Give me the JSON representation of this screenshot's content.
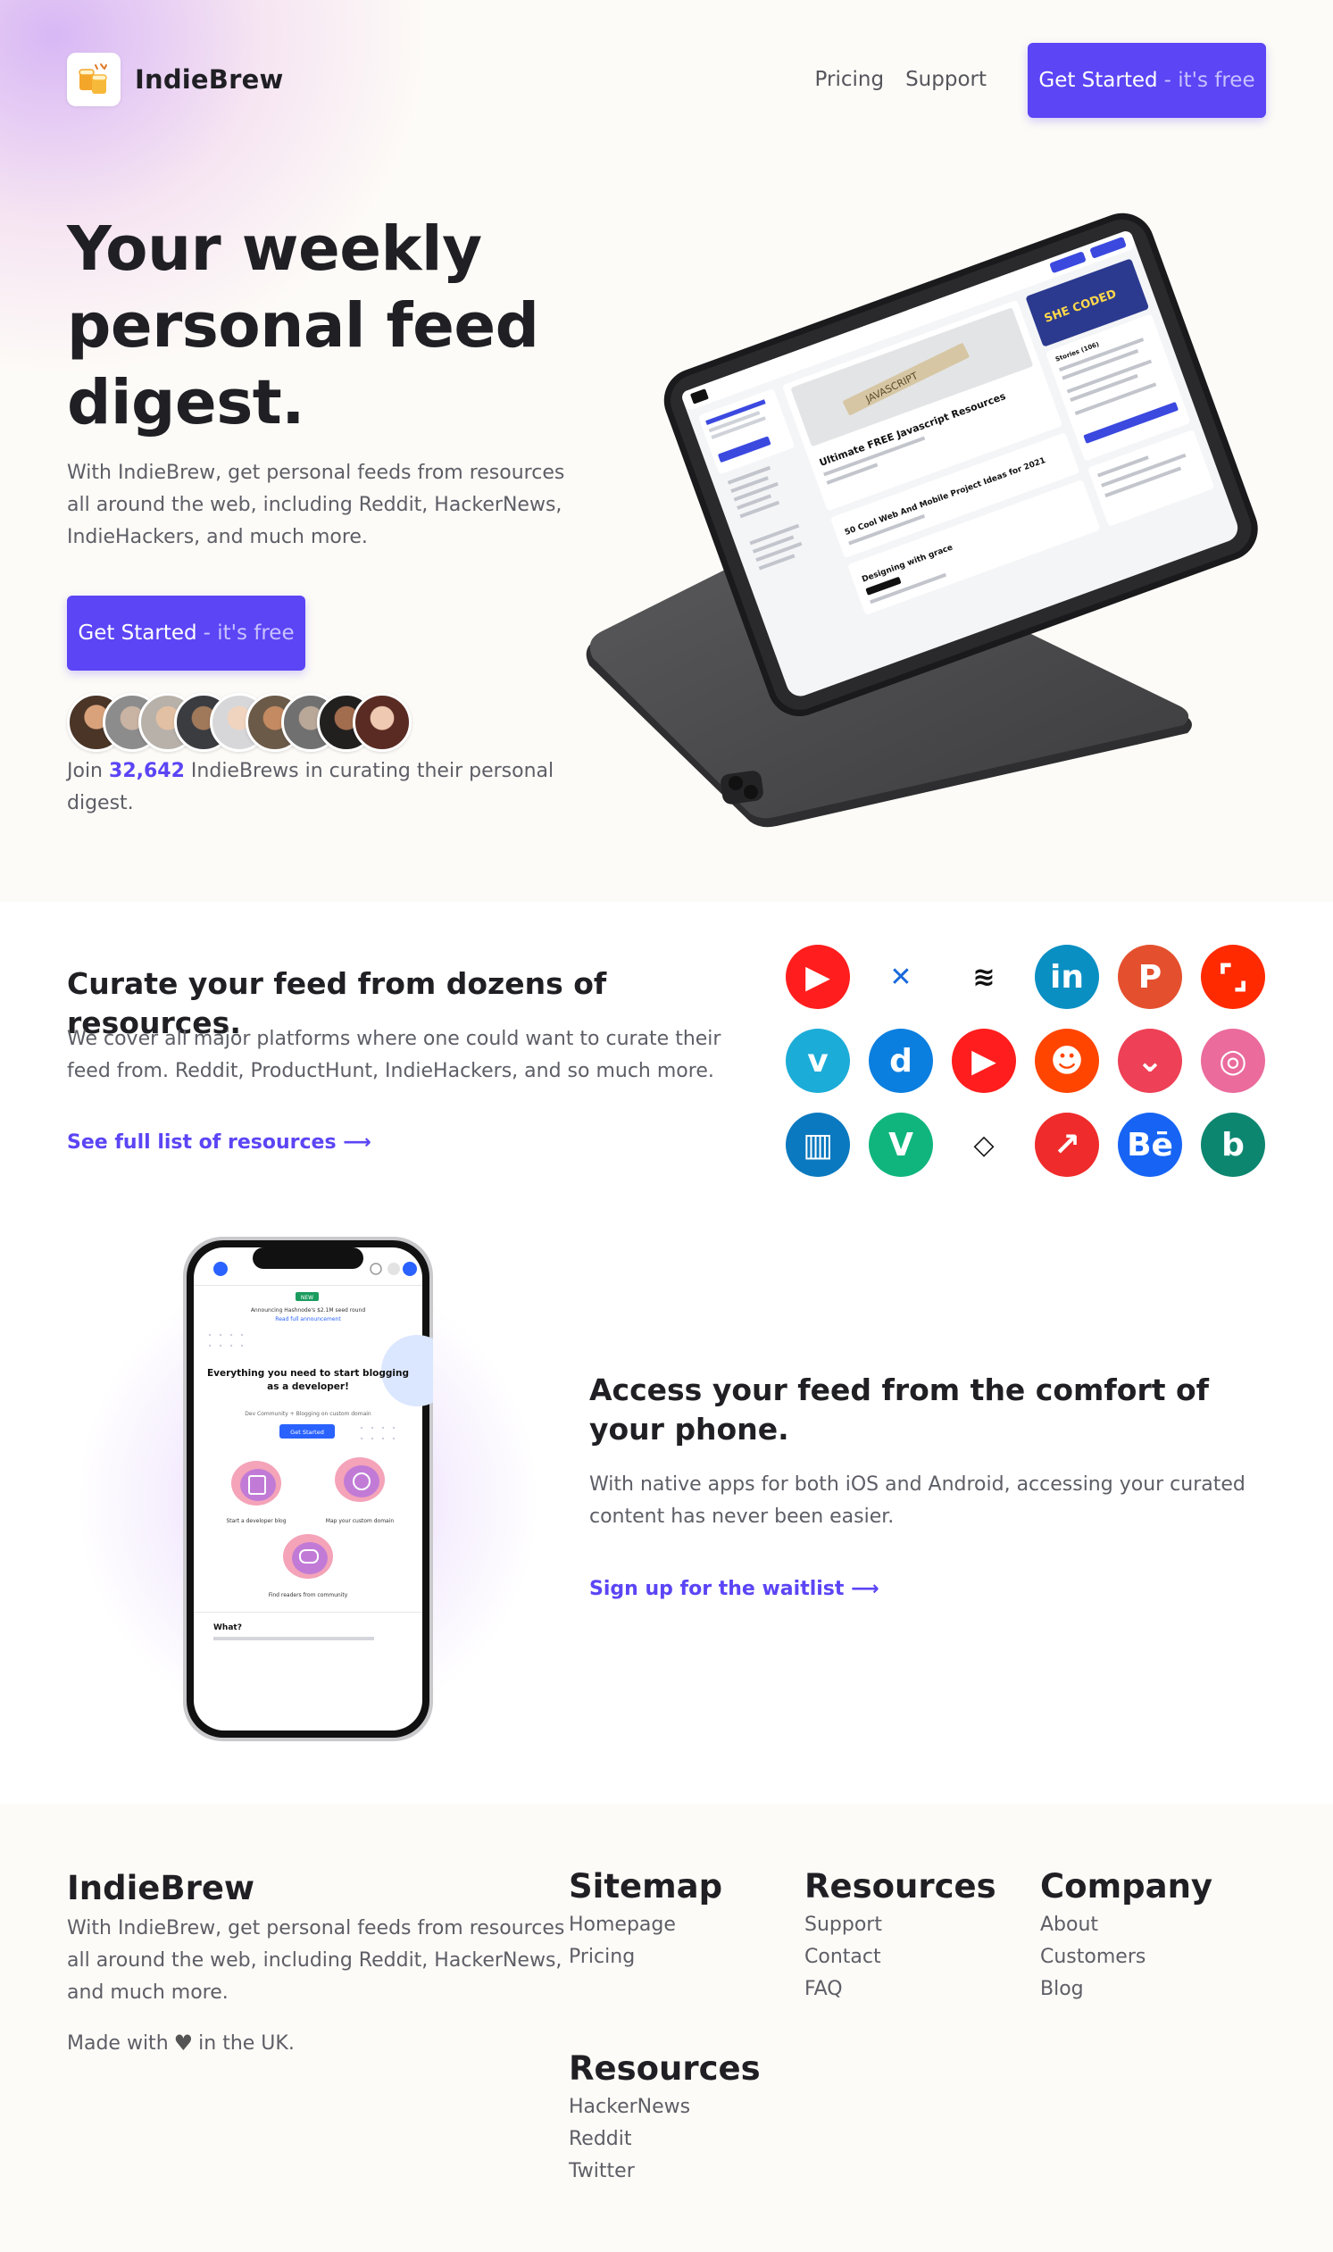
{
  "nav": {
    "brand": "IndieBrew",
    "links": [
      "Pricing",
      "Support"
    ],
    "cta_main": "Get Started",
    "cta_muted": "- it's free"
  },
  "hero": {
    "title": "Your weekly personal feed digest.",
    "subtitle": "With IndieBrew, get personal feeds from resources all around the web, including Reddit, HackerNews, IndieHackers, and much more.",
    "cta_main": "Get Started",
    "cta_muted": "- it's free",
    "join_prefix": "Join",
    "join_count": "32,642",
    "join_suffix": "IndieBrews in curating their personal digest."
  },
  "tablet": {
    "story_count": "Stories (106)",
    "post1": "Ultimate FREE Javascript Resources",
    "post2": "50 Cool Web And Mobile Project Ideas for 2021",
    "post3": "Designing with grace",
    "banner": "SHE CODED",
    "photo_word": "JAVASCRIPT"
  },
  "resources": {
    "title": "Curate your feed from dozens of resources.",
    "text": "We cover all major platforms where one could want to curate their feed from. Reddit, ProductHunt, IndieHackers, and so much more.",
    "link": "See full list of resources",
    "icons": [
      {
        "name": "youtube-icon",
        "bg": "#ff1d1d",
        "fg": "#ffffff",
        "glyph": "▶",
        "ring": false
      },
      {
        "name": "confluence-icon",
        "bg": "#ffffff",
        "fg": "#1868db",
        "glyph": "✕",
        "ring": false
      },
      {
        "name": "buffer-icon",
        "bg": "#ffffff",
        "fg": "#111111",
        "glyph": "≋",
        "ring": false
      },
      {
        "name": "linkedin-icon",
        "bg": "#0a8fc3",
        "fg": "#ffffff",
        "glyph": "in",
        "ring": false
      },
      {
        "name": "producthunt-icon",
        "bg": "#e4502e",
        "fg": "#ffffff",
        "glyph": "P",
        "ring": false
      },
      {
        "name": "speakerdeck-icon",
        "bg": "#ff2a00",
        "fg": "#ffffff",
        "glyph": "⌜⌟",
        "ring": false
      },
      {
        "name": "vimeo-icon",
        "bg": "#1cacd8",
        "fg": "#ffffff",
        "glyph": "v",
        "ring": false
      },
      {
        "name": "dailymotion-icon",
        "bg": "#0b7fe0",
        "fg": "#ffffff",
        "glyph": "d",
        "ring": false
      },
      {
        "name": "youtube-icon",
        "bg": "#ff1d1d",
        "fg": "#ffffff",
        "glyph": "▶",
        "ring": false
      },
      {
        "name": "reddit-icon",
        "bg": "#ff4500",
        "fg": "#ffffff",
        "glyph": "☻",
        "ring": false
      },
      {
        "name": "pocket-icon",
        "bg": "#ee4056",
        "fg": "#ffffff",
        "glyph": "⌄",
        "ring": false
      },
      {
        "name": "dribbble-icon",
        "bg": "#ea6b9c",
        "fg": "#ffffff",
        "glyph": "◎",
        "ring": false
      },
      {
        "name": "trello-icon",
        "bg": "#0b79bf",
        "fg": "#ffffff",
        "glyph": "▥",
        "ring": false
      },
      {
        "name": "vine-icon",
        "bg": "#10b57d",
        "fg": "#ffffff",
        "glyph": "V",
        "ring": false
      },
      {
        "name": "codepen-icon",
        "bg": "#ffffff",
        "fg": "#111111",
        "glyph": "◇",
        "ring": false
      },
      {
        "name": "trending-icon",
        "bg": "#ef2b2b",
        "fg": "#ffffff",
        "glyph": "↗",
        "ring": false
      },
      {
        "name": "behance-icon",
        "bg": "#1764f4",
        "fg": "#ffffff",
        "glyph": "Bē",
        "ring": false
      },
      {
        "name": "bing-icon",
        "bg": "#0d8670",
        "fg": "#ffffff",
        "glyph": "b",
        "ring": false
      }
    ]
  },
  "phone": {
    "title": "Access your feed from the comfort of your phone.",
    "text": "With native apps for both iOS and Android, accessing your curated content has never been easier.",
    "link": "Sign up for the waitlist",
    "screen": {
      "badge": "NEW",
      "announce": "Announcing Hashnode's $2.1M seed round",
      "announce_link": "Read full announcement",
      "headline": "Everything you need to start blogging as a developer!",
      "tagline": "Dev Community + Blogging on custom domain",
      "cta": "Get Started",
      "feature1": "Start a developer blog",
      "feature2": "Map your custom domain",
      "feature3": "Find readers from community",
      "what": "What?"
    }
  },
  "footer": {
    "brand": "IndieBrew",
    "desc": "With IndieBrew, get personal feeds from resources all around the web, including Reddit, HackerNews, and much more.",
    "made_prefix": "Made with",
    "made_suffix": "in the UK.",
    "sitemap": {
      "title": "Sitemap",
      "links": [
        "Homepage",
        "Pricing"
      ]
    },
    "resources": {
      "title": "Resources",
      "links": [
        "Support",
        "Contact",
        "FAQ"
      ]
    },
    "company": {
      "title": "Company",
      "links": [
        "About",
        "Customers",
        "Blog"
      ]
    },
    "resources2": {
      "title": "Resources",
      "links": [
        "HackerNews",
        "Reddit",
        "Twitter"
      ]
    }
  },
  "colors": {
    "primary": "#5b45f5",
    "text": "#1f1f24",
    "muted": "#5d5e66",
    "background": "#fdfbf7"
  }
}
